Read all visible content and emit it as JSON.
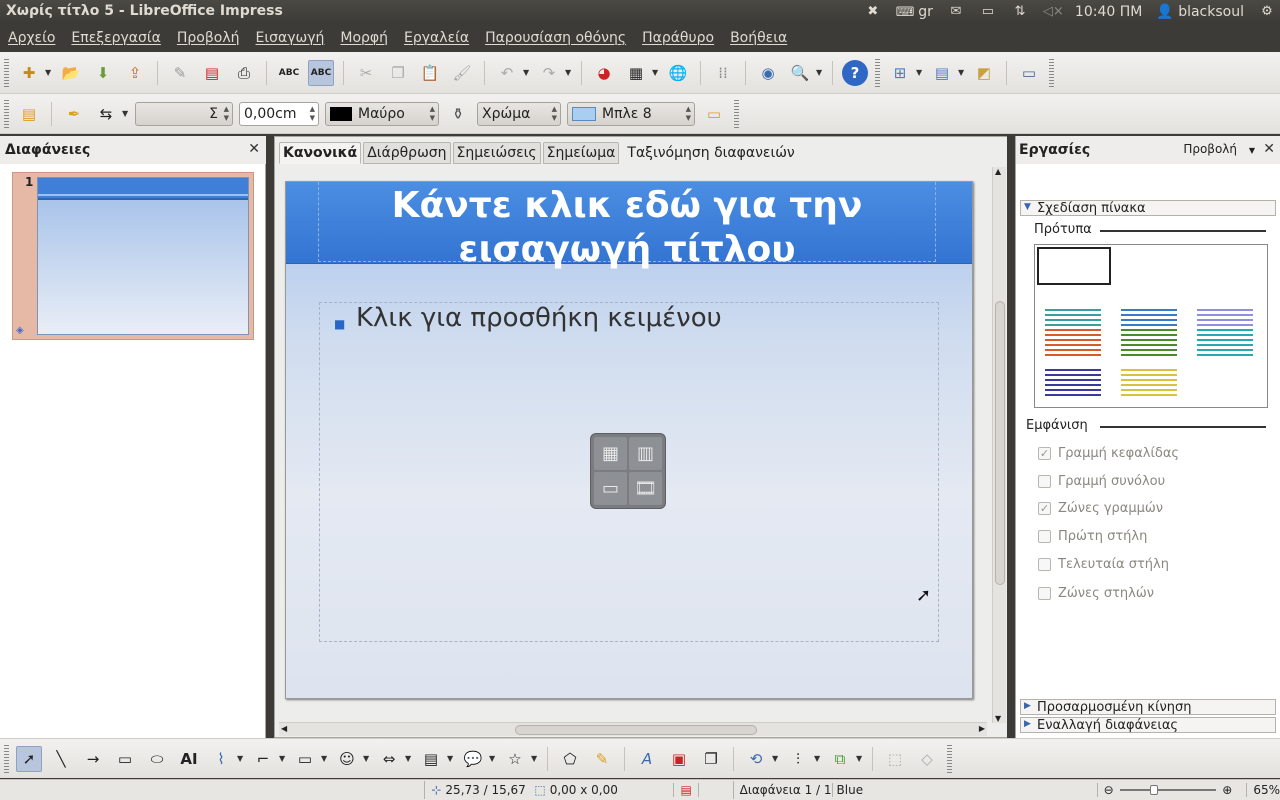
{
  "window": {
    "title": "Χωρίς τίτλο 5 - LibreOffice Impress"
  },
  "tray": {
    "keyboard": "gr",
    "time": "10:40 ΠΜ",
    "user": "blacksoul"
  },
  "menubar": [
    "Αρχείο",
    "Επεξεργασία",
    "Προβολή",
    "Εισαγωγή",
    "Μορφή",
    "Εργαλεία",
    "Παρουσίαση οθόνης",
    "Παράθυρο",
    "Βοήθεια"
  ],
  "toolbar2": {
    "line_width": "0,00cm",
    "line_color": "Μαύρο",
    "area_style": "Χρώμα",
    "area_color": "Μπλε 8",
    "line_style_symbol": "Σ"
  },
  "slides_pane": {
    "title": "Διαφάνειες",
    "thumb_number": "1"
  },
  "view_tabs": [
    "Κανονικά",
    "Διάρθρωση",
    "Σημειώσεις",
    "Σημείωμα",
    "Ταξινόμηση διαφανειών"
  ],
  "slide": {
    "title_placeholder": "Κάντε κλικ εδώ για την εισαγωγή τίτλου",
    "body_placeholder": "Κλικ για προσθήκη κειμένου"
  },
  "tasks_pane": {
    "title": "Εργασίες",
    "view_label": "Προβολή",
    "section_table": "Σχεδίαση πίνακα",
    "templates_label": "Πρότυπα",
    "appearance_label": "Εμφάνιση",
    "options": [
      {
        "label": "Γραμμή κεφαλίδας",
        "checked": true
      },
      {
        "label": "Γραμμή συνόλου",
        "checked": false
      },
      {
        "label": "Ζώνες γραμμών",
        "checked": true
      },
      {
        "label": "Πρώτη στήλη",
        "checked": false
      },
      {
        "label": "Τελευταία στήλη",
        "checked": false
      },
      {
        "label": "Ζώνες στηλών",
        "checked": false
      }
    ],
    "section_animation": "Προσαρμοσμένη κίνηση",
    "section_transition": "Εναλλαγή διαφάνειας"
  },
  "status": {
    "position": "25,73 / 15,67",
    "size": "0,00 x 0,00",
    "slide": "Διαφάνεια 1 / 1",
    "master": "Blue",
    "zoom": "65%"
  },
  "colors": {
    "title_band": "#3374d2",
    "accent": "#4b8ee2",
    "table_templates": [
      "#3a9ea0",
      "#3a7bc8",
      "#8f8fe0",
      "#d55a2e",
      "#4a8a2a",
      "#2aa8b0",
      "#3a3a9a",
      "#d8c040"
    ]
  }
}
